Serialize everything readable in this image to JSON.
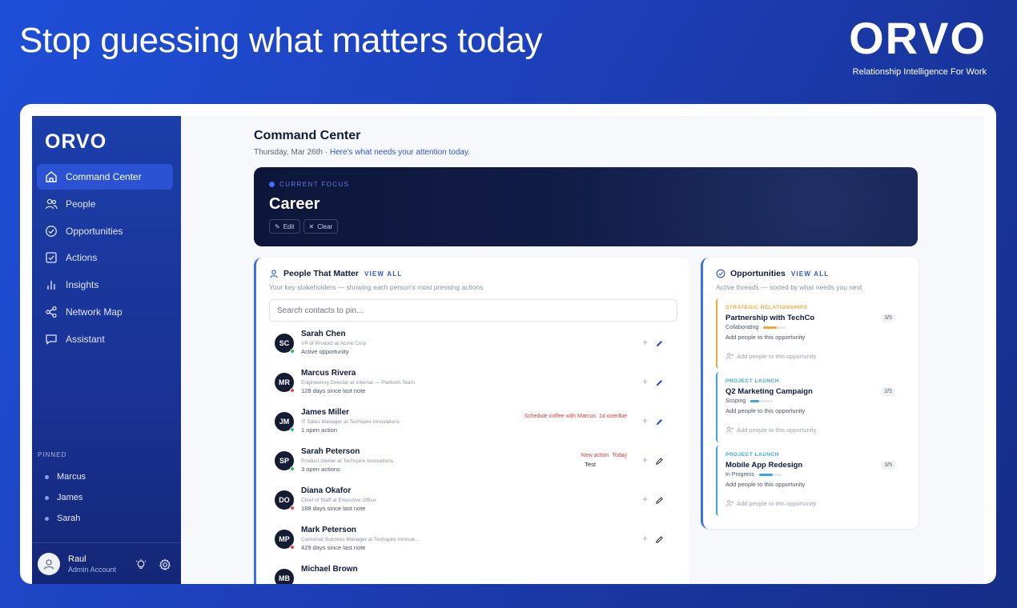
{
  "banner": {
    "headline": "Stop guessing what matters today",
    "logo": "ORVO",
    "tagline": "Relationship Intelligence For Work"
  },
  "sidebar": {
    "logo": "ORVO",
    "items": [
      {
        "label": "Command Center",
        "icon": "home-icon",
        "active": true
      },
      {
        "label": "People",
        "icon": "people-icon"
      },
      {
        "label": "Opportunities",
        "icon": "check-circle-icon"
      },
      {
        "label": "Actions",
        "icon": "check-square-icon"
      },
      {
        "label": "Insights",
        "icon": "bar-chart-icon"
      },
      {
        "label": "Network Map",
        "icon": "share-nodes-icon"
      },
      {
        "label": "Assistant",
        "icon": "chat-icon"
      }
    ],
    "pinned_title": "PINNED",
    "pinned": [
      "Marcus",
      "James",
      "Sarah"
    ],
    "user": {
      "name": "Raul",
      "role": "Admin Account"
    }
  },
  "main": {
    "title": "Command Center",
    "date": "Thursday, Mar 26th ·",
    "date_link": "Here's what needs your attention today.",
    "focus": {
      "label": "CURRENT FOCUS",
      "title": "Career",
      "edit": "Edit",
      "clear": "Clear"
    }
  },
  "people": {
    "title": "People That Matter",
    "view_all": "VIEW ALL",
    "subtitle": "Your key stakeholders — showing each person's most pressing actions",
    "search_placeholder": "Search contacts to pin...",
    "rows": [
      {
        "initials": "SC",
        "name": "Sarah Chen",
        "role": "VP of Product at Acme Corp",
        "note": "Active opportunity",
        "status": "green",
        "action": "",
        "due": "",
        "action_sub": ""
      },
      {
        "initials": "MR",
        "name": "Marcus Rivera",
        "role": "Engineering Director at Internal — Platform Team",
        "note": "128 days since last note",
        "status": "red",
        "action": "",
        "due": "",
        "action_sub": ""
      },
      {
        "initials": "JM",
        "name": "James Miller",
        "role": "IT Sales Manager at Techspire Innovations",
        "note": "1 open action",
        "status": "green",
        "action": "Schedule coffee with Marcus",
        "due": "1d overdue",
        "action_sub": ""
      },
      {
        "initials": "SP",
        "name": "Sarah Peterson",
        "role": "Product Owner at Techspire Innovations",
        "note": "3 open actions",
        "status": "green",
        "action": "New action",
        "due": "Today",
        "action_sub": "Test"
      },
      {
        "initials": "DO",
        "name": "Diana Okafor",
        "role": "Chief of Staff at Executive Office",
        "note": "188 days since last note",
        "status": "red",
        "action": "",
        "due": "",
        "action_sub": ""
      },
      {
        "initials": "MP",
        "name": "Mark Peterson",
        "role": "Customer Success Manager at Techspire Innovat...",
        "note": "429 days since last note",
        "status": "red",
        "action": "",
        "due": "",
        "action_sub": ""
      },
      {
        "initials": "MB",
        "name": "Michael Brown",
        "role": "",
        "note": "",
        "status": "",
        "action": "",
        "due": "",
        "action_sub": ""
      }
    ]
  },
  "opportunities": {
    "title": "Opportunities",
    "view_all": "VIEW ALL",
    "subtitle": "Active threads — sorted by what needs you next",
    "items": [
      {
        "category": "STRATEGIC RELATIONSHIPS",
        "category_color": "#f1a83a",
        "name": "Partnership with TechCo",
        "count": "3/5",
        "stage": "Collaborating",
        "progress": 0.6,
        "add": "Add people to this opportunity",
        "add_people": "Add people to this opportunity"
      },
      {
        "category": "PROJECT LAUNCH",
        "category_color": "#38a9e0",
        "name": "Q2 Marketing Campaign",
        "count": "2/5",
        "stage": "Scoping",
        "progress": 0.4,
        "add": "Add people to this opportunity",
        "add_people": "Add people to this opportunity"
      },
      {
        "category": "PROJECT LAUNCH",
        "category_color": "#38a9e0",
        "name": "Mobile App Redesign",
        "count": "3/5",
        "stage": "In Progress",
        "progress": 0.6,
        "add": "Add people to this opportunity",
        "add_people": "Add people to this opportunity"
      }
    ]
  },
  "colors": {
    "accent": "#2a56d6",
    "status_green": "#22c55e",
    "status_red": "#ef4444",
    "alert": "#e23b3b"
  }
}
